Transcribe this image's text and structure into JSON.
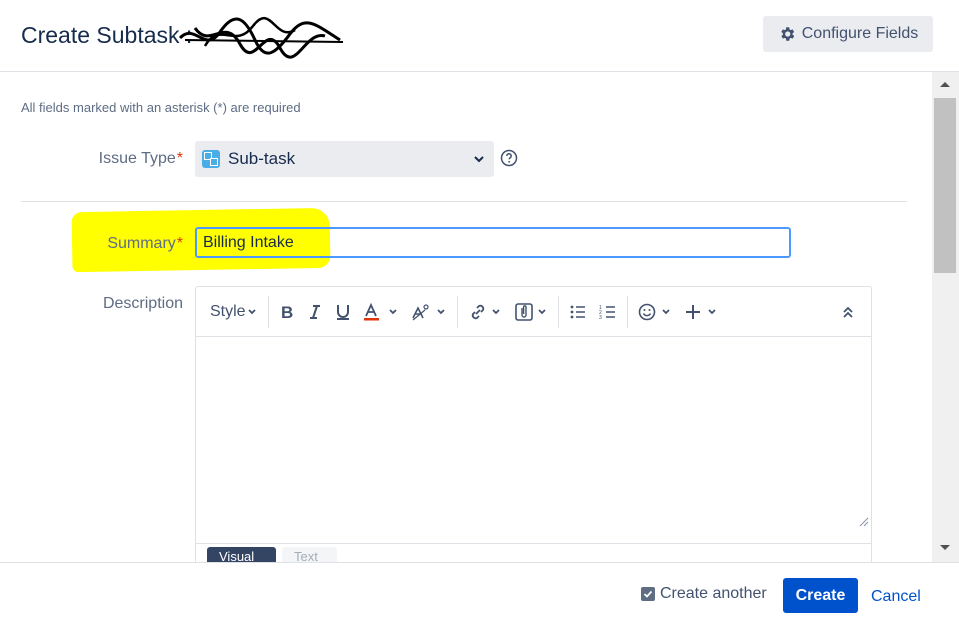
{
  "header": {
    "title": "Create Subtask :",
    "configure_label": "Configure Fields"
  },
  "form": {
    "required_note": "All fields marked with an asterisk (*) are required",
    "issue_type_label": "Issue Type",
    "issue_type_value": "Sub-task",
    "summary_label": "Summary",
    "summary_value": "Billing Intake",
    "description_label": "Description",
    "required_marker": "*"
  },
  "editor": {
    "style_label": "Style",
    "toolbar_icons": [
      "bold-icon",
      "italic-icon",
      "underline-icon",
      "text-color-icon",
      "text-format-icon",
      "link-icon",
      "attachment-icon",
      "bullet-list-icon",
      "numbered-list-icon",
      "emoji-icon",
      "insert-more-icon",
      "collapse-toolbar-icon"
    ],
    "modes": [
      "Visual",
      "Text"
    ]
  },
  "footer": {
    "create_another_label": "Create another",
    "create_another_checked": true,
    "create_label": "Create",
    "cancel_label": "Cancel"
  },
  "colors": {
    "primary": "#0052cc",
    "focus": "#4c9aff",
    "required": "#de350b",
    "highlight": "#ffff00"
  }
}
